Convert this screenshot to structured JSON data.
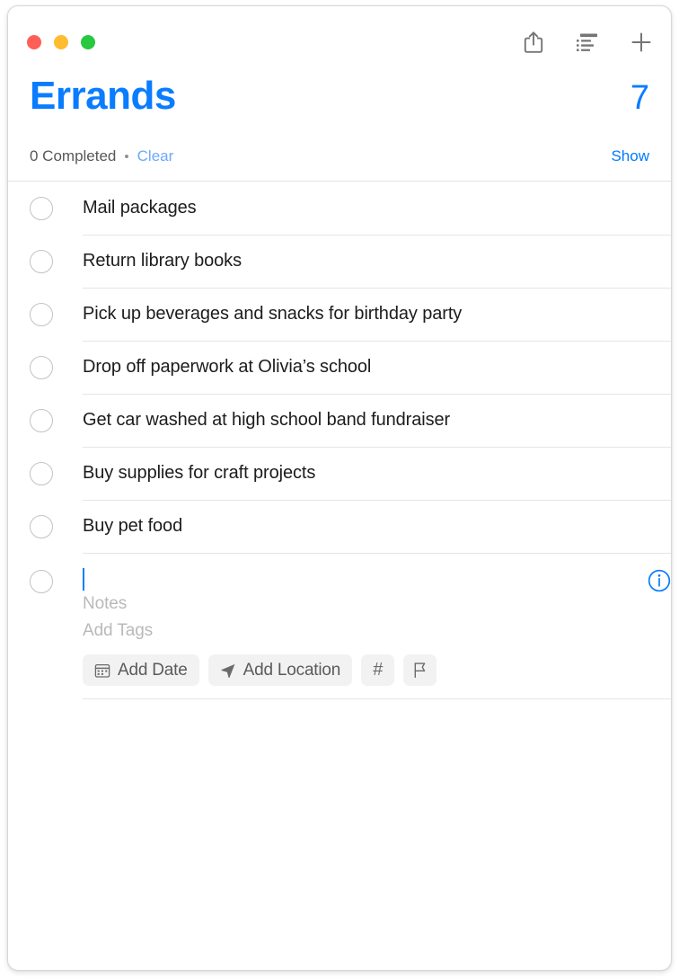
{
  "window": {
    "traffic_lights": [
      {
        "name": "close",
        "color": "#ff5f57"
      },
      {
        "name": "minimize",
        "color": "#febc2e"
      },
      {
        "name": "zoom",
        "color": "#28c840"
      }
    ],
    "toolbar": [
      {
        "name": "share-icon",
        "label": "Share"
      },
      {
        "name": "list-view-icon",
        "label": "View Options"
      },
      {
        "name": "add-icon",
        "label": "Add Reminder"
      }
    ]
  },
  "header": {
    "title": "Errands",
    "count": "7",
    "completed_text": "0 Completed",
    "separator_dot": "•",
    "clear_label": "Clear",
    "show_label": "Show",
    "accent_color": "#0a7cff",
    "clear_color": "#6ea8fb"
  },
  "reminders": [
    {
      "title": "Mail packages",
      "completed": false
    },
    {
      "title": "Return library books",
      "completed": false
    },
    {
      "title": "Pick up beverages and snacks for birthday party",
      "completed": false
    },
    {
      "title": "Drop off paperwork at Olivia’s school",
      "completed": false
    },
    {
      "title": "Get car washed at high school band fundraiser",
      "completed": false
    },
    {
      "title": "Buy supplies for craft projects",
      "completed": false
    },
    {
      "title": "Buy pet food",
      "completed": false
    }
  ],
  "new_reminder": {
    "value": "",
    "notes_placeholder": "Notes",
    "tags_placeholder": "Add Tags",
    "chips": [
      {
        "name": "add-date",
        "label": "Add Date",
        "icon": "calendar-icon"
      },
      {
        "name": "add-location",
        "label": "Add Location",
        "icon": "location-arrow-icon"
      },
      {
        "name": "add-tag",
        "label": "#",
        "icon": "hash-icon"
      },
      {
        "name": "add-flag",
        "label": "",
        "icon": "flag-icon"
      }
    ],
    "info_button": "info-icon"
  }
}
